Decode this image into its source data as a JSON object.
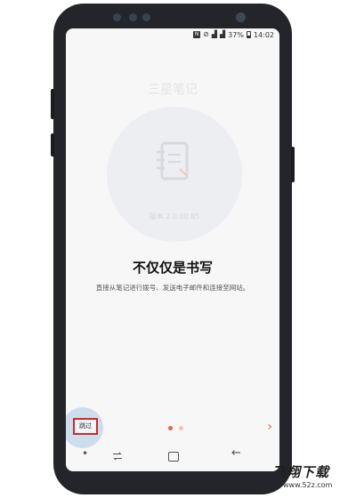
{
  "status_bar": {
    "nfc_label": "N",
    "battery_percent": "37%",
    "time": "14:02"
  },
  "app": {
    "title": "三星笔记",
    "version": "版本 2.0.00.85",
    "headline": "不仅仅是书写",
    "description": "直接从笔记进行拨号、发送电子邮件和连接至网站。"
  },
  "controls": {
    "skip_label": "跳过",
    "next_icon": "chevron-right-icon",
    "page_count": 2,
    "active_page": 1
  },
  "colors": {
    "accent": "#e0654a",
    "inactive_dot": "#f3c2b6",
    "highlight_box": "#d42828",
    "screen_bg": "#f7f7f8"
  },
  "nav_bar": {
    "icons": [
      "dot-icon",
      "recent-apps-icon",
      "home-icon",
      "back-icon"
    ]
  },
  "watermark": {
    "logo": "飞翔下载",
    "url": "www.52z.com"
  }
}
